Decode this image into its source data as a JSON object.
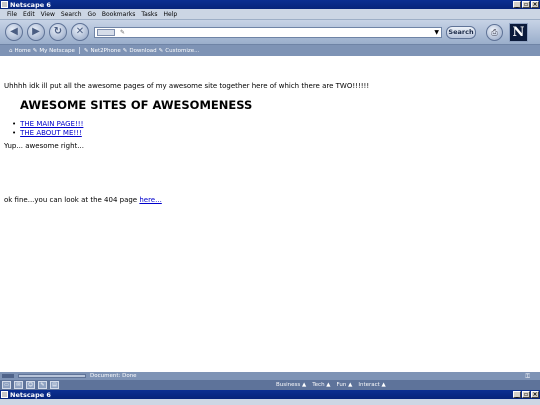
{
  "window": {
    "title": "Netscape 6"
  },
  "menu": [
    "File",
    "Edit",
    "View",
    "Search",
    "Go",
    "Bookmarks",
    "Tasks",
    "Help"
  ],
  "toolbar": {
    "search_label": "Search",
    "logo_letter": "N"
  },
  "personal_toolbar": [
    "Home",
    "My Netscape",
    "Net2Phone",
    "Download",
    "Customize..."
  ],
  "content": {
    "intro": "Uhhhh idk ill put all the awesome pages of my awesome site together here of which there are TWO!!!!!!",
    "heading": "AWESOME SITES OF AWESOMENESS",
    "links": [
      "THE MAIN PAGE!!!",
      "THE ABOUT ME!!!"
    ],
    "yup": "Yup... awesome right...",
    "p404_text": "ok fine...you can look at the 404 page ",
    "p404_link": "here..."
  },
  "status": {
    "text": "Document: Done"
  },
  "component_bar": {
    "tabs": [
      "Business ▲",
      "Tech ▲",
      "Fun ▲",
      "Interact ▲"
    ]
  },
  "window2": {
    "title": "Netscape 6"
  }
}
